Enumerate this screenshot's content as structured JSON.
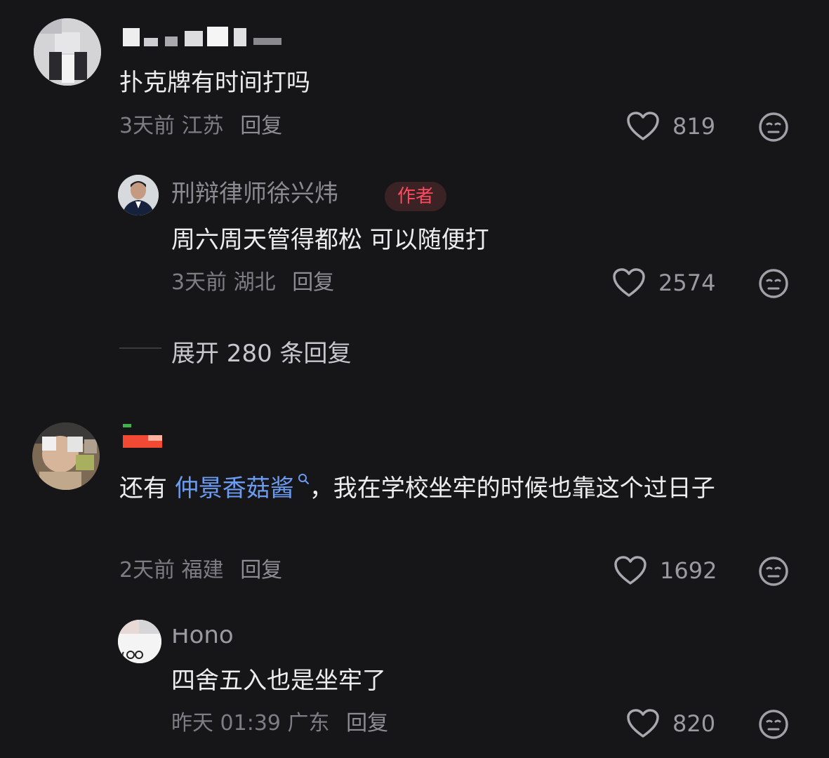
{
  "comments": [
    {
      "name": "",
      "text": "扑克牌有时间打吗",
      "time": "3天前",
      "location": "江苏",
      "reply_label": "回复",
      "likes": "819",
      "replies": [
        {
          "name": "刑辩律师徐兴炜",
          "badge": "作者",
          "text": "周六周天管得都松 可以随便打",
          "time": "3天前",
          "location": "湖北",
          "reply_label": "回复",
          "likes": "2574"
        }
      ],
      "expand_label": "展开 280 条回复"
    },
    {
      "name": "",
      "text_before": "还有 ",
      "mention": "仲景香菇酱",
      "text_after": "，我在学校坐牢的时候也靠这个过日子",
      "time": "2天前",
      "location": "福建",
      "reply_label": "回复",
      "likes": "1692",
      "replies": [
        {
          "name": "Hono",
          "text": "四舍五入也是坐牢了",
          "time": "昨天 01:39",
          "location": "广东",
          "reply_label": "回复",
          "likes": "820"
        }
      ]
    }
  ],
  "colors": {
    "background": "#161619",
    "mention": "#6b9cf2",
    "badge_text": "#ff4a5e"
  },
  "icons": [
    "heart-icon",
    "neutral-face-icon",
    "search-icon"
  ]
}
